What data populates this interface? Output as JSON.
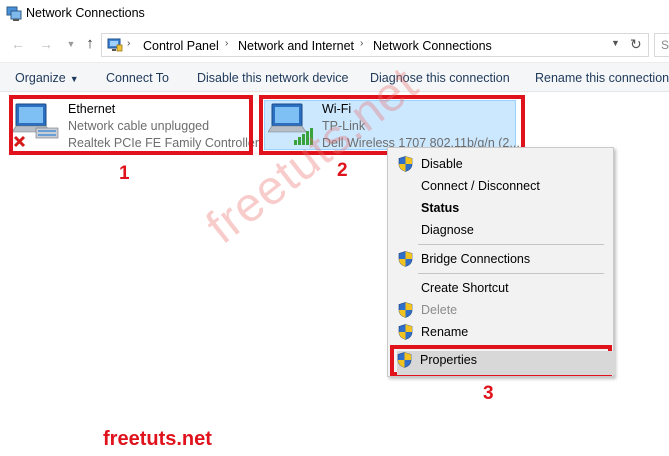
{
  "window": {
    "title": "Network Connections"
  },
  "address": {
    "crumbs": [
      "Control Panel",
      "Network and Internet",
      "Network Connections"
    ]
  },
  "toolbar": {
    "organize": "Organize",
    "connect_to": "Connect To",
    "disable_device": "Disable this network device",
    "diagnose": "Diagnose this connection",
    "rename": "Rename this connection"
  },
  "connections": [
    {
      "name": "Ethernet",
      "status": "Network cable unplugged",
      "adapter": "Realtek PCIe FE Family Controller",
      "icon": "ethernet-adapter-icon"
    },
    {
      "name": "Wi-Fi",
      "status": "TP-Link",
      "adapter": "Dell Wireless 1707 802.11b/g/n (2....",
      "icon": "wifi-adapter-icon"
    }
  ],
  "context_menu": {
    "items": [
      {
        "label": "Disable",
        "shield": true
      },
      {
        "label": "Connect / Disconnect",
        "shield": false
      },
      {
        "label": "Status",
        "shield": false,
        "bold": true
      },
      {
        "label": "Diagnose",
        "shield": false
      },
      {
        "label": "Bridge Connections",
        "shield": true
      },
      {
        "label": "Create Shortcut",
        "shield": false
      },
      {
        "label": "Delete",
        "shield": true,
        "disabled": true
      },
      {
        "label": "Rename",
        "shield": true
      },
      {
        "label": "Properties",
        "shield": true,
        "highlighted": true
      }
    ]
  },
  "annotations": {
    "step1": "1",
    "step2": "2",
    "step3": "3",
    "watermark": "freetuts.net",
    "brand": "freetuts.net"
  },
  "colors": {
    "highlight_red": "#e0131d",
    "selection_blue": "#cce8ff",
    "command_text": "#1e395b"
  }
}
